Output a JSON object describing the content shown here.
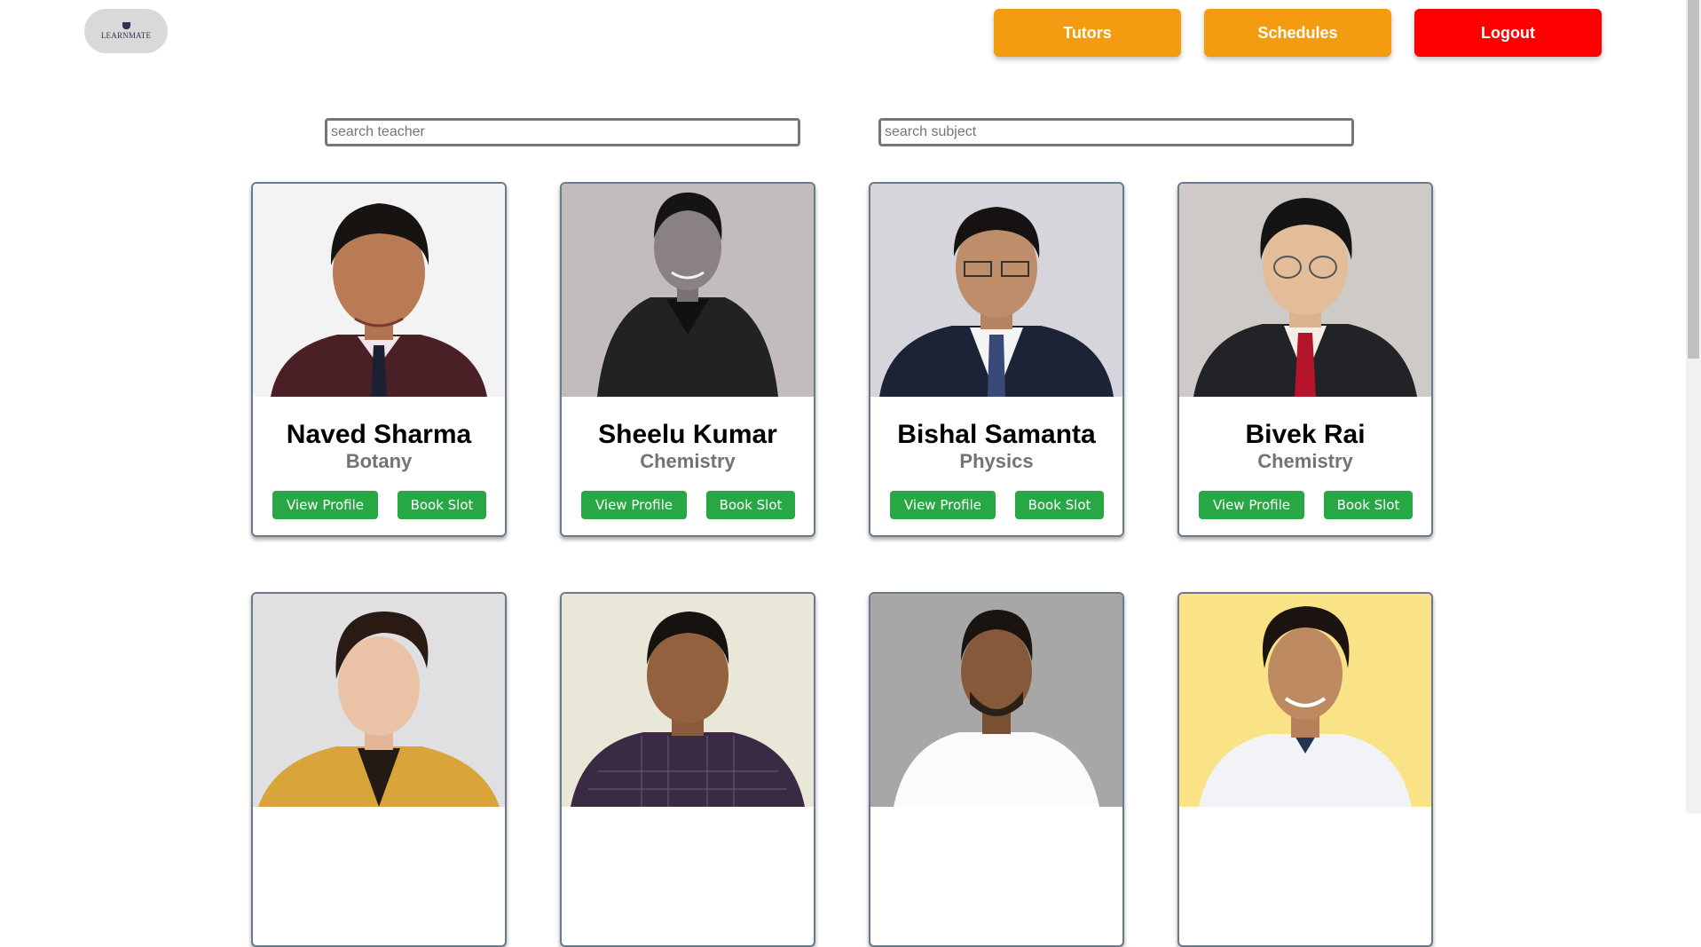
{
  "header": {
    "logo_text": "LEARNMATE",
    "nav": {
      "tutors": "Tutors",
      "schedules": "Schedules",
      "logout": "Logout"
    }
  },
  "colors": {
    "nav_orange": "#f39c12",
    "logout_red": "#ff0000",
    "action_green": "#28a745"
  },
  "search": {
    "teacher_placeholder": "search teacher",
    "subject_placeholder": "search subject"
  },
  "buttons": {
    "view_profile": "View Profile",
    "book_slot": "Book Slot"
  },
  "tutors": [
    {
      "name": "Naved Sharma",
      "subject": "Botany"
    },
    {
      "name": "Sheelu Kumar",
      "subject": "Chemistry"
    },
    {
      "name": "Bishal Samanta",
      "subject": "Physics"
    },
    {
      "name": "Bivek Rai",
      "subject": "Chemistry"
    },
    {
      "name": "",
      "subject": ""
    },
    {
      "name": "",
      "subject": ""
    },
    {
      "name": "",
      "subject": ""
    },
    {
      "name": "",
      "subject": ""
    }
  ]
}
